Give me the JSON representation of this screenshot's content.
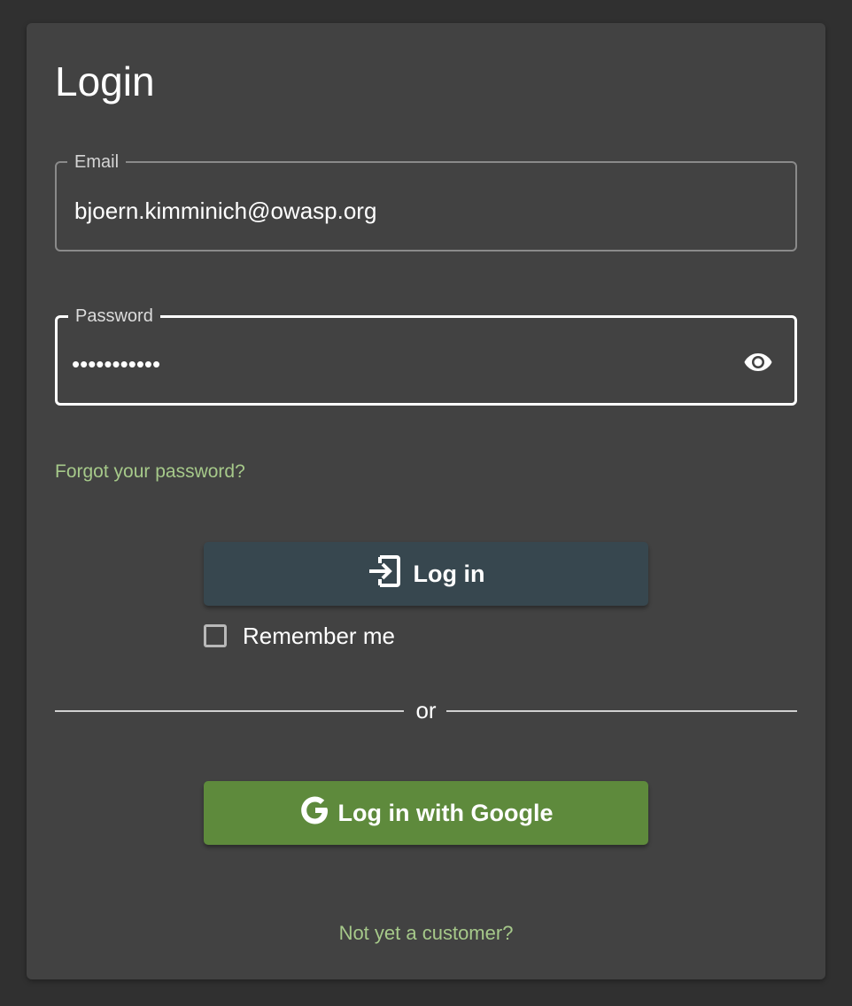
{
  "title": "Login",
  "email": {
    "label": "Email",
    "value": "bjoern.kimminich@owasp.org"
  },
  "password": {
    "label": "Password",
    "masked_value": "•••••••••••",
    "toggle_icon": "eye-icon"
  },
  "forgot_password_link": "Forgot your password?",
  "login_button": {
    "label": "Log in",
    "icon": "login-icon",
    "color": "#37474f"
  },
  "remember_me": {
    "label": "Remember me",
    "checked": false
  },
  "divider_text": "or",
  "google_button": {
    "label": "Log in with Google",
    "icon": "google-icon",
    "color": "#5e8a3c"
  },
  "register_link": "Not yet a customer?",
  "colors": {
    "background": "#303030",
    "card": "#424242",
    "link": "#a6c98a"
  }
}
